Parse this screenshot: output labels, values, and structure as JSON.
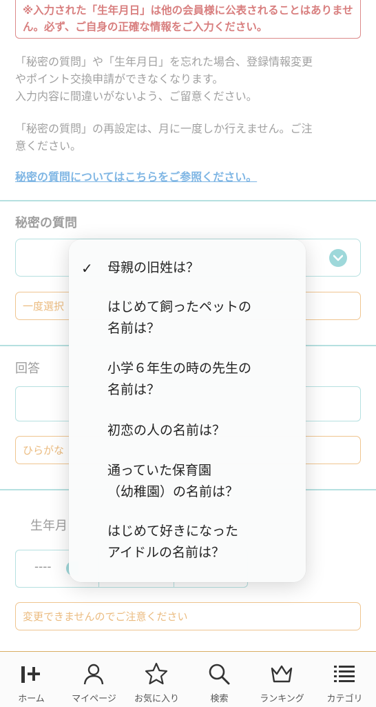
{
  "notice": {
    "warning": "※入力された「生年月日」は他の会員様に公表されることはありません。必ず、ご自身の正確な情報をご入力ください。",
    "para1_line1": "「秘密の質問」や「生年月日」を忘れた場合、登録情報変更",
    "para1_line2": "やポイント交換申請ができなくなります。",
    "para1_line3": "入力内容に間違いがないよう、ご留意ください。",
    "para2_line1": "「秘密の質問」の再設定は、月に一度しか行えません。ご注",
    "para2_line2": "意ください。",
    "link": "秘密の質問についてはこちらをご参照ください。"
  },
  "form": {
    "secret_question_label": "秘密の質問",
    "once_select_note": "一度選択",
    "answer_label": "回答",
    "hiragana_note": "ひらがな",
    "birthday_label": "生年月",
    "birthday_year_value": "----",
    "birthday_note": "変更できませんのでご注意ください"
  },
  "dropdown": {
    "options": [
      {
        "line1": "母親の旧姓は？",
        "line2": "",
        "selected": true
      },
      {
        "line1": "はじめて飼ったペットの",
        "line2": "名前は？",
        "selected": false
      },
      {
        "line1": "小学６年生の時の先生の",
        "line2": "名前は？",
        "selected": false
      },
      {
        "line1": "初恋の人の名前は？",
        "line2": "",
        "selected": false
      },
      {
        "line1": "通っていた保育園",
        "line2": "（幼稚園）の名前は？",
        "selected": false
      },
      {
        "line1": "はじめて好きになった",
        "line2": "アイドルの名前は？",
        "selected": false
      }
    ],
    "check_mark": "✓"
  },
  "tabbar": {
    "tabs": [
      {
        "label": "ホーム",
        "icon": "home-logo-icon"
      },
      {
        "label": "マイページ",
        "icon": "person-icon"
      },
      {
        "label": "お気に入り",
        "icon": "star-icon"
      },
      {
        "label": "検索",
        "icon": "search-icon"
      },
      {
        "label": "ランキング",
        "icon": "crown-icon"
      },
      {
        "label": "カテゴリ",
        "icon": "list-icon"
      }
    ]
  },
  "colors": {
    "warning": "#c43a3a",
    "link": "#3b8fd6",
    "teal": "#6bc3c7",
    "orange": "#e0973b",
    "tabbar_border": "#d9ad62"
  }
}
